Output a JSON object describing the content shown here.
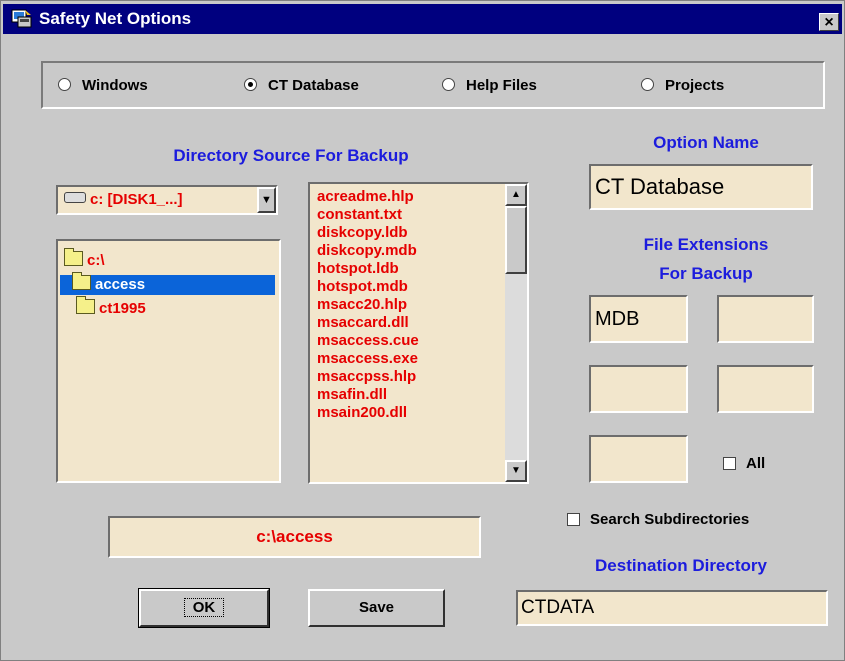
{
  "window": {
    "title": "Safety Net Options",
    "close_label": "×"
  },
  "radios": [
    {
      "label": "Windows",
      "selected": false
    },
    {
      "label": "CT Database",
      "selected": true
    },
    {
      "label": "Help Files",
      "selected": false
    },
    {
      "label": "Projects",
      "selected": false
    }
  ],
  "source": {
    "heading": "Directory Source For Backup",
    "drive": "c: [DISK1_...]",
    "tree": [
      "c:\\",
      "access",
      "ct1995"
    ],
    "selected_folder": "access",
    "files": [
      "acreadme.hlp",
      "constant.txt",
      "diskcopy.ldb",
      "diskcopy.mdb",
      "hotspot.ldb",
      "hotspot.mdb",
      "msacc20.hlp",
      "msaccard.dll",
      "msaccess.cue",
      "msaccess.exe",
      "msaccpss.hlp",
      "msafin.dll",
      "msain200.dll"
    ],
    "path": "c:\\access"
  },
  "option": {
    "heading": "Option Name",
    "value": "CT Database"
  },
  "extensions": {
    "heading_line1": "File Extensions",
    "heading_line2": "For Backup",
    "values": [
      "MDB",
      "",
      "",
      "",
      ""
    ],
    "all_label": "All"
  },
  "search_subdirectories": {
    "label": "Search Subdirectories"
  },
  "destination": {
    "heading": "Destination Directory",
    "value": "CTDATA"
  },
  "buttons": {
    "ok": "OK",
    "save": "Save"
  },
  "colors": {
    "title_bar": "#00007f",
    "heading_blue": "#1c1cdd",
    "file_red": "#e60000",
    "field_bg": "#f2e6cc"
  }
}
